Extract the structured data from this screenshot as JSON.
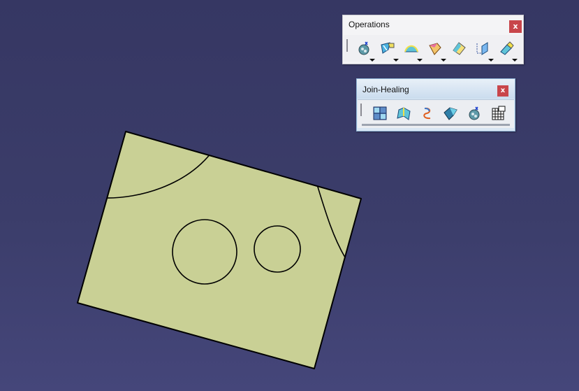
{
  "viewport": {
    "background_top": "#363763",
    "background_bottom": "#45467a",
    "part_fill": "#c9d095",
    "edge_color": "#000000",
    "sketch": "rotated plate with two arc edges and two circular holes"
  },
  "toolbars": {
    "operations": {
      "title": "Operations",
      "close_label": "x",
      "buttons": [
        {
          "icon": "join-icon",
          "has_dropdown": true
        },
        {
          "icon": "split-icon",
          "has_dropdown": true
        },
        {
          "icon": "boundary-icon",
          "has_dropdown": true
        },
        {
          "icon": "extract-icon",
          "has_dropdown": true
        },
        {
          "icon": "shape-fillet-icon",
          "has_dropdown": false
        },
        {
          "icon": "translate-icon",
          "has_dropdown": true
        },
        {
          "icon": "extrapolate-icon",
          "has_dropdown": true
        }
      ]
    },
    "join_healing": {
      "title": "Join-Healing",
      "close_label": "x",
      "buttons": [
        {
          "icon": "join-surfaces-icon"
        },
        {
          "icon": "healing-icon"
        },
        {
          "icon": "curve-smooth-icon"
        },
        {
          "icon": "untrim-icon"
        },
        {
          "icon": "disassemble-icon"
        },
        {
          "icon": "grid-table-icon"
        }
      ]
    }
  }
}
